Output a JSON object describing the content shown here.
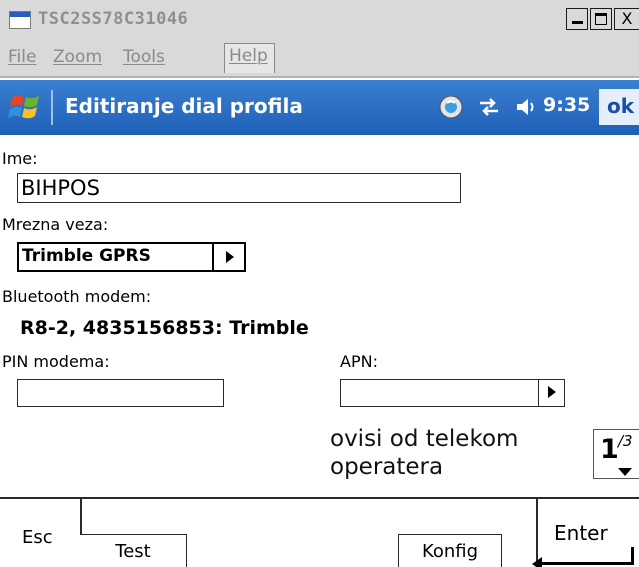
{
  "window": {
    "title": "TSC2SS78C31046",
    "min_label": "_",
    "close_label": "X",
    "menu": [
      "File",
      "Zoom",
      "Tools",
      "Help"
    ]
  },
  "header": {
    "title": "Editiranje dial profila",
    "time": "9:35",
    "ok_label": "ok"
  },
  "form": {
    "ime_label": "Ime:",
    "ime_value": "BIHPOS",
    "mrezna_label": "Mrezna veza:",
    "mrezna_value": "Trimble GPRS",
    "bt_label": "Bluetooth modem:",
    "bt_value": "R8-2, 4835156853: Trimble",
    "pin_label": "PIN modema:",
    "pin_value": "",
    "apn_label": "APN:",
    "apn_value": "",
    "note_line1": "ovisi od telekom",
    "note_line2": "operatera"
  },
  "pager": {
    "page": "1",
    "total": "/3"
  },
  "softkeys": {
    "esc": "Esc",
    "test": "Test",
    "konfig": "Konfig",
    "enter": "Enter"
  },
  "colors": {
    "header_blue": "#2466bd",
    "title_gray": "#8f8f8f",
    "menu_bg": "#d9d9d9"
  }
}
